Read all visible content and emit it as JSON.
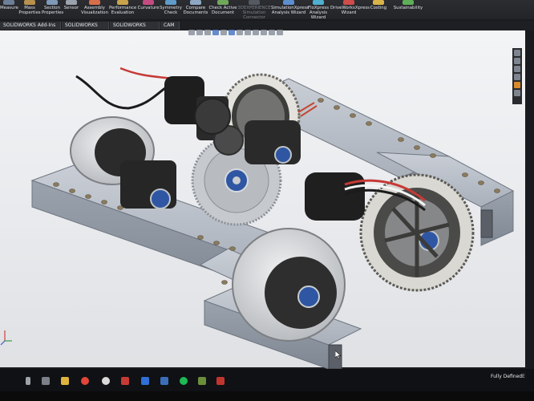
{
  "ribbon": {
    "items": [
      {
        "label": "Measure",
        "dim": false
      },
      {
        "label": "Mass\nProperties",
        "dim": false
      },
      {
        "label": "Section\nProperties",
        "dim": false
      },
      {
        "label": "Sensor",
        "dim": false
      },
      {
        "label": "Assembly\nVisualization",
        "dim": false
      },
      {
        "label": "Performance\nEvaluation",
        "dim": false
      },
      {
        "label": "Curvature",
        "dim": false
      },
      {
        "label": "Symmetry\nCheck",
        "dim": false
      },
      {
        "label": "Compare\nDocuments",
        "dim": false
      },
      {
        "label": "Check Active\nDocument",
        "dim": false
      },
      {
        "label": "3DEXPERIENCE\nSimulation\nConnector",
        "dim": true
      },
      {
        "label": "SimulationXpress\nAnalysis Wizard",
        "dim": false
      },
      {
        "label": "FloXpress\nAnalysis\nWizard",
        "dim": false
      },
      {
        "label": "DriveWorksXpress\nWizard",
        "dim": false
      },
      {
        "label": "Costing",
        "dim": false
      },
      {
        "label": "Sustainability",
        "dim": false
      }
    ]
  },
  "tabs": [
    {
      "label": "SOLIDWORKS Add-Ins"
    },
    {
      "label": "SOLIDWORKS MBD"
    },
    {
      "label": "SOLIDWORKS CAM"
    },
    {
      "label": "CAM"
    }
  ],
  "statusbar": {
    "status_text": "Fully Defined",
    "trailing": "E"
  },
  "taskbar": {
    "icons": [
      "microphone-icon",
      "task-view-icon",
      "file-explorer-icon",
      "chrome-icon",
      "itunes-icon",
      "app-icon",
      "mail-icon",
      "photos-icon",
      "spotify-icon",
      "minecraft-icon",
      "solidworks-icon"
    ]
  },
  "colors": {
    "accent": "#4b79c4",
    "ribbon_bg": "#2c2d31",
    "viewport_bg": "#eceef0"
  }
}
